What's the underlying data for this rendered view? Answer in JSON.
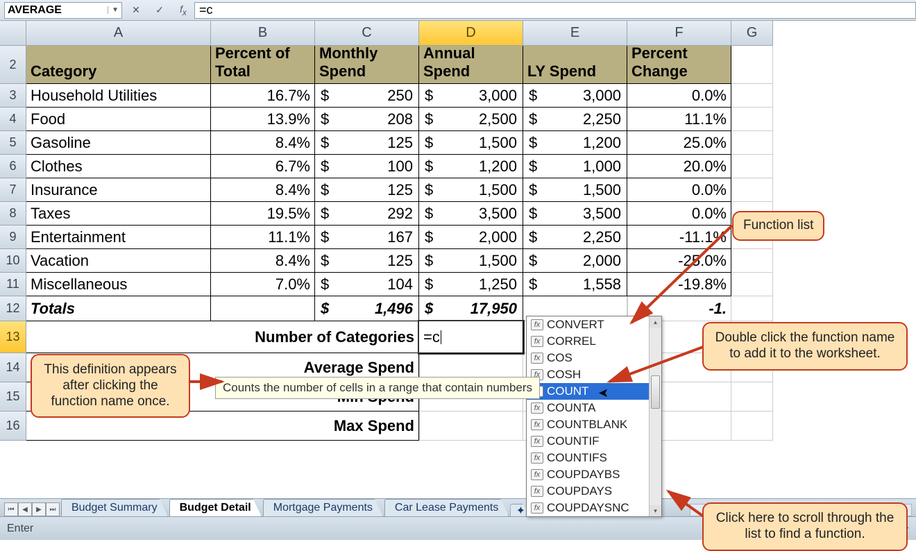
{
  "nameBox": "AVERAGE",
  "formula": "=c",
  "columns": [
    "A",
    "B",
    "C",
    "D",
    "E",
    "F",
    "G"
  ],
  "activeCol": "D",
  "activeRow": 13,
  "headers": {
    "A": "Category",
    "B": "Percent of Total",
    "C": "Monthly Spend",
    "D": "Annual Spend",
    "E": "LY Spend",
    "F": "Percent Change"
  },
  "rows": [
    {
      "n": 3,
      "cat": "Household Utilities",
      "pct": "16.7%",
      "c": "250",
      "d": "3,000",
      "e": "3,000",
      "f": "0.0%"
    },
    {
      "n": 4,
      "cat": "Food",
      "pct": "13.9%",
      "c": "208",
      "d": "2,500",
      "e": "2,250",
      "f": "11.1%"
    },
    {
      "n": 5,
      "cat": "Gasoline",
      "pct": "8.4%",
      "c": "125",
      "d": "1,500",
      "e": "1,200",
      "f": "25.0%"
    },
    {
      "n": 6,
      "cat": "Clothes",
      "pct": "6.7%",
      "c": "100",
      "d": "1,200",
      "e": "1,000",
      "f": "20.0%"
    },
    {
      "n": 7,
      "cat": "Insurance",
      "pct": "8.4%",
      "c": "125",
      "d": "1,500",
      "e": "1,500",
      "f": "0.0%"
    },
    {
      "n": 8,
      "cat": "Taxes",
      "pct": "19.5%",
      "c": "292",
      "d": "3,500",
      "e": "3,500",
      "f": "0.0%"
    },
    {
      "n": 9,
      "cat": "Entertainment",
      "pct": "11.1%",
      "c": "167",
      "d": "2,000",
      "e": "2,250",
      "f": "-11.1%"
    },
    {
      "n": 10,
      "cat": "Vacation",
      "pct": "8.4%",
      "c": "125",
      "d": "1,500",
      "e": "2,000",
      "f": "-25.0%"
    },
    {
      "n": 11,
      "cat": "Miscellaneous",
      "pct": "7.0%",
      "c": "104",
      "d": "1,250",
      "e": "1,558",
      "f": "-19.8%"
    }
  ],
  "totals": {
    "label": "Totals",
    "c": "1,496",
    "d": "17,950",
    "f": "-1."
  },
  "labels": {
    "numCat": "Number of Categories",
    "avg": "Average Spend",
    "min": "Min Spend",
    "max": "Max Spend"
  },
  "activeCellValue": "=c",
  "tooltip": "Counts the number of cells in a range that contain numbers",
  "funcs": [
    "CONVERT",
    "CORREL",
    "COS",
    "COSH",
    "COUNT",
    "COUNTA",
    "COUNTBLANK",
    "COUNTIF",
    "COUNTIFS",
    "COUPDAYBS",
    "COUPDAYS",
    "COUPDAYSNC"
  ],
  "funcSelected": "COUNT",
  "callouts": {
    "def": "This definition appears after clicking the function name once.",
    "list": "Function list",
    "dbl": "Double click the function name to add it to the worksheet.",
    "scroll": "Click here to scroll through the list to find a function."
  },
  "tabs": [
    "Budget Summary",
    "Budget Detail",
    "Mortgage Payments",
    "Car Lease Payments"
  ],
  "activeTab": "Budget Detail",
  "status": "Enter",
  "chart_data": {
    "type": "table",
    "title": "Budget Detail",
    "columns": [
      "Category",
      "Percent of Total",
      "Monthly Spend",
      "Annual Spend",
      "LY Spend",
      "Percent Change"
    ],
    "rows": [
      [
        "Household Utilities",
        "16.7%",
        250,
        3000,
        3000,
        "0.0%"
      ],
      [
        "Food",
        "13.9%",
        208,
        2500,
        2250,
        "11.1%"
      ],
      [
        "Gasoline",
        "8.4%",
        125,
        1500,
        1200,
        "25.0%"
      ],
      [
        "Clothes",
        "6.7%",
        100,
        1200,
        1000,
        "20.0%"
      ],
      [
        "Insurance",
        "8.4%",
        125,
        1500,
        1500,
        "0.0%"
      ],
      [
        "Taxes",
        "19.5%",
        292,
        3500,
        3500,
        "0.0%"
      ],
      [
        "Entertainment",
        "11.1%",
        167,
        2000,
        2250,
        "-11.1%"
      ],
      [
        "Vacation",
        "8.4%",
        125,
        1500,
        2000,
        "-25.0%"
      ],
      [
        "Miscellaneous",
        "7.0%",
        104,
        1250,
        1558,
        "-19.8%"
      ]
    ],
    "totals": [
      "Totals",
      "",
      1496,
      17950,
      "",
      ""
    ]
  }
}
